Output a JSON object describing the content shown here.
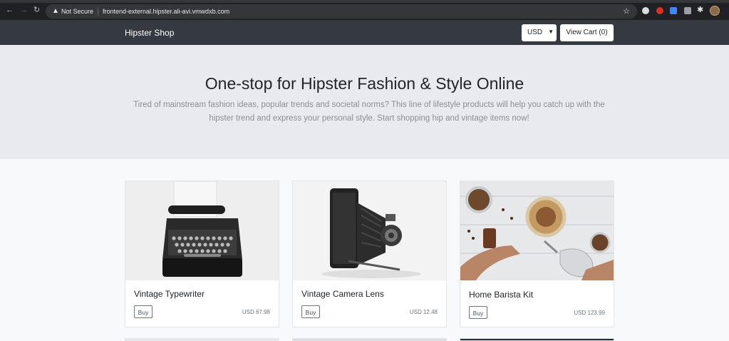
{
  "browser": {
    "back_icon": "arrow-left-icon",
    "forward_icon": "arrow-right-icon",
    "reload_icon": "reload-icon",
    "security_label": "Not Secure",
    "url": "frontend-external.hipster.ali-avi.vmwdxb.com",
    "bookmark_icon": "star-icon"
  },
  "header": {
    "brand": "Hipster Shop",
    "currency": "USD",
    "cart_label": "View Cart (0)"
  },
  "hero": {
    "title": "One-stop for Hipster Fashion & Style Online",
    "subtitle": "Tired of mainstream fashion ideas, popular trends and societal norms? This line of lifestyle products will help you catch up with the hipster trend and express your personal style. Start shopping hip and vintage items now!"
  },
  "products": [
    {
      "name": "Vintage Typewriter",
      "buy_label": "Buy",
      "price": "USD 67.98"
    },
    {
      "name": "Vintage Camera Lens",
      "buy_label": "Buy",
      "price": "USD 12.48"
    },
    {
      "name": "Home Barista Kit",
      "buy_label": "Buy",
      "price": "USD 123.99"
    }
  ]
}
